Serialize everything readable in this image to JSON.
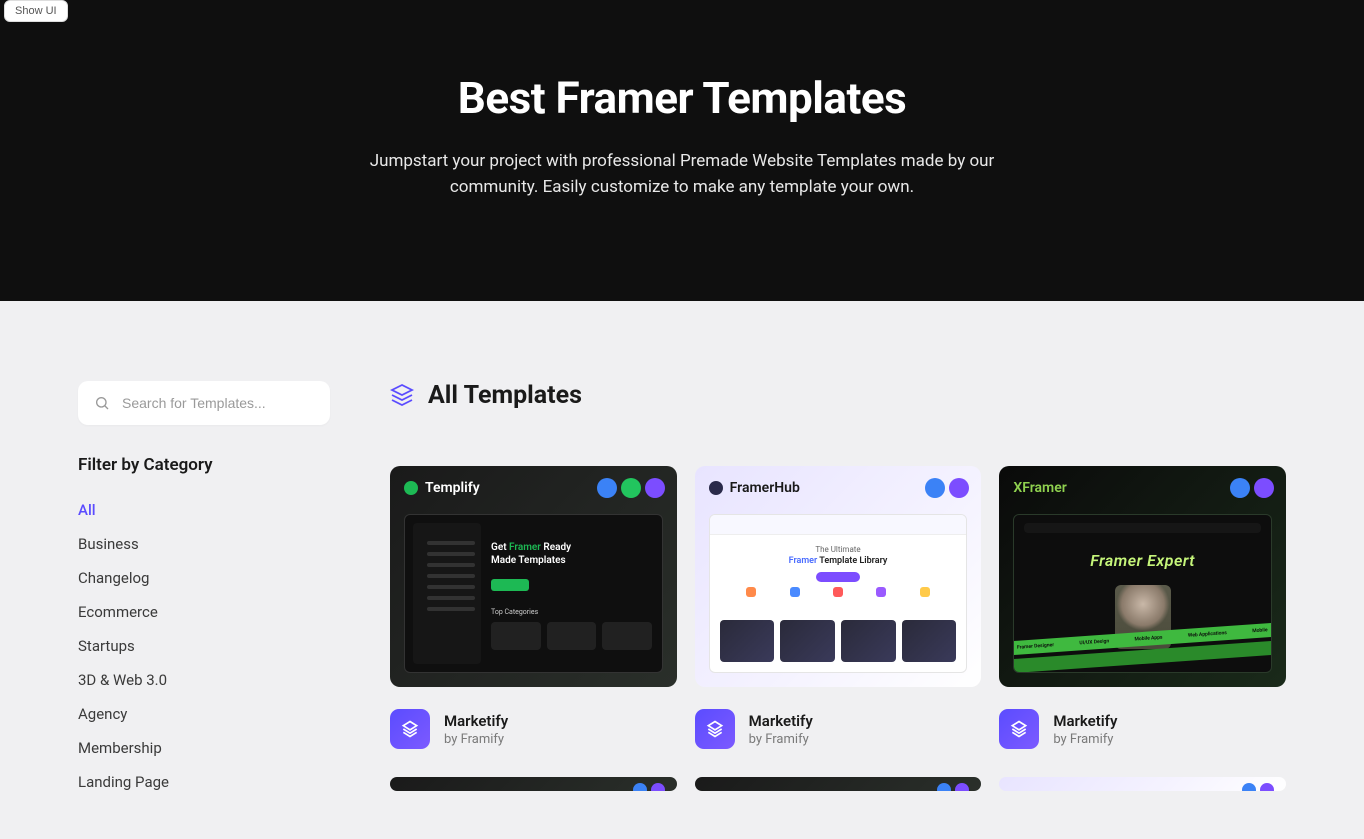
{
  "showUI": "Show UI",
  "hero": {
    "title": "Best Framer Templates",
    "subtitle": "Jumpstart your project with professional Premade Website Templates made by our community. Easily customize to make any template your own."
  },
  "sidebar": {
    "search_placeholder": "Search for Templates...",
    "filter_title": "Filter by Category",
    "categories": [
      {
        "label": "All",
        "active": true
      },
      {
        "label": "Business",
        "active": false
      },
      {
        "label": "Changelog",
        "active": false
      },
      {
        "label": "Ecommerce",
        "active": false
      },
      {
        "label": "Startups",
        "active": false
      },
      {
        "label": "3D & Web 3.0",
        "active": false
      },
      {
        "label": "Agency",
        "active": false
      },
      {
        "label": "Membership",
        "active": false
      },
      {
        "label": "Landing Page",
        "active": false
      }
    ]
  },
  "content": {
    "title": "All Templates"
  },
  "thumbs": {
    "templify": {
      "brand": "Templify",
      "heading_pre": "Get ",
      "heading_accent": "Framer",
      "heading_post": " Ready Made Templates",
      "section_label": "Top Categories"
    },
    "framerhub": {
      "brand": "FramerHub",
      "line1": "The Ultimate",
      "line2_accent": "Framer",
      "line2_post": " Template Library"
    },
    "xframer": {
      "brand": "XFramer",
      "title": "Framer Expert",
      "stripe_items": [
        "Framer Designer",
        "UI/UX Design",
        "Mobile Apps",
        "Web Applications",
        "Mobile"
      ]
    }
  },
  "cards": [
    {
      "title": "Marketify",
      "author": "by Framify",
      "thumb": "templify"
    },
    {
      "title": "Marketify",
      "author": "by Framify",
      "thumb": "framerhub"
    },
    {
      "title": "Marketify",
      "author": "by Framify",
      "thumb": "xframer"
    }
  ]
}
